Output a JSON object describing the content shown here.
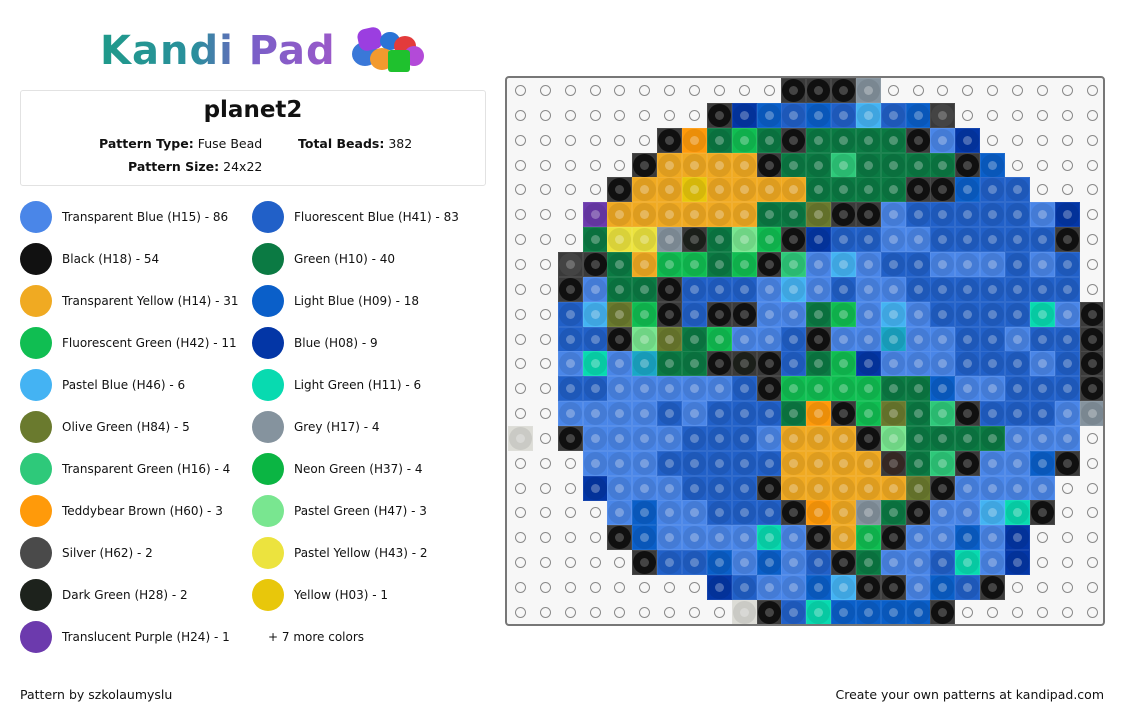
{
  "brand": {
    "name": "Kandi Pad"
  },
  "pattern": {
    "title": "planet2",
    "type_label": "Pattern Type:",
    "type_value": "Fuse Bead",
    "total_label": "Total Beads:",
    "total_value": "382",
    "size_label": "Pattern Size:",
    "size_value": "24x22"
  },
  "legend": {
    "items": [
      {
        "label": "Transparent Blue (H15) - 86",
        "color": "#4a86e8"
      },
      {
        "label": "Fluorescent Blue (H41) - 83",
        "color": "#2160c8"
      },
      {
        "label": "Black (H18) - 54",
        "color": "#111111"
      },
      {
        "label": "Green (H10) - 40",
        "color": "#0b7a43"
      },
      {
        "label": "Transparent Yellow (H14) - 31",
        "color": "#f0aa22"
      },
      {
        "label": "Light Blue (H09) - 18",
        "color": "#0a5fc9"
      },
      {
        "label": "Fluorescent Green (H42) - 11",
        "color": "#10be52"
      },
      {
        "label": "Blue (H08) - 9",
        "color": "#0336a6"
      },
      {
        "label": "Pastel Blue (H46) - 6",
        "color": "#44b3f3"
      },
      {
        "label": "Light Green (H11) - 6",
        "color": "#08dab0"
      },
      {
        "label": "Olive Green (H84) - 5",
        "color": "#6a7a2e"
      },
      {
        "label": "Grey (H17) - 4",
        "color": "#85939e"
      },
      {
        "label": "Transparent Green (H16) - 4",
        "color": "#2ec97a"
      },
      {
        "label": "Neon Green (H37) - 4",
        "color": "#0bb543"
      },
      {
        "label": "Teddybear Brown (H60) - 3",
        "color": "#ff9a0a"
      },
      {
        "label": "Pastel Green (H47) - 3",
        "color": "#79e690"
      },
      {
        "label": "Silver (H62) - 2",
        "color": "#4a4a4a"
      },
      {
        "label": "Pastel Yellow (H43) - 2",
        "color": "#ece33e"
      },
      {
        "label": "Dark Green (H28) - 2",
        "color": "#1d221c"
      },
      {
        "label": "Yellow (H03) - 1",
        "color": "#e8c70b"
      },
      {
        "label": "Translucent Purple (H24) - 1",
        "color": "#6c3aad"
      }
    ],
    "more_label": "+ 7 more colors"
  },
  "board": {
    "columns": 24,
    "rows": 22,
    "palette": {
      "B": "#4a86e8",
      "F": "#2160c8",
      "K": "#111111",
      "G": "#0b7a43",
      "Y": "#f0aa22",
      "L": "#0a5fc9",
      "N": "#10be52",
      "D": "#0336a6",
      "p": "#44b3f3",
      "M": "#08dab0",
      "O": "#6a7a2e",
      "Q": "#85939e",
      "T": "#2ec97a",
      "E": "#0bb543",
      "R": "#ff9a0a",
      "P": "#79e690",
      "S": "#4a4a4a",
      "W": "#ece33e",
      "X": "#1d221c",
      "U": "#e8c70b",
      "V": "#6c3aad",
      "C": "#1aa7c7",
      "Z": "#3a2a26",
      "w": "#dcdcd6"
    },
    "grid": [
      "...........KKKQ.........",
      "........KDLFLFpFLS......",
      "......KRGNGKGGGGKBD.....",
      ".....KYYYYKGGTGGGGKL....",
      "....KYYUYYYYGGGGKKLFF...",
      "...VYYYYYYGGOKKBFFFFFBD..",
      "...GWWQXGPNKDFFBBFFFFFK.",
      "..SKGYNNGNKTBpBFFBBBFBF.",
      "..KBGGKFFFBpBFBBFFFFFFF.",
      "..FpONKFKKBBGNBpBFFFFMBK",
      "..FFKPOGNBBFKBBCBBFFBFFK",
      "..BMBCGGKXKFGNDBBBFFFBFK",
      "..FFBBBBBFKNNNNGGLBBFFFK",
      "..BBBBFBFFFGRKNOGTKFFFBQ",
      "w.KBBBBFFFBYYYKPGGGGBBB.",
      "...BBBFFFFFYYYYZGTKBBLK.",
      "...DBBBFFFKYYYYYOKBBBB..",
      "....BLBBFFFKRYQGKBBpMK..",
      "....KLBBBBMBKYNKBBLBD...",
      ".....KFFLBLBFKGBBFMBD...",
      "........DFBBLpKKBLFK....",
      ".........wKFMLLLLK......"
    ]
  },
  "footer": {
    "credit": "Pattern by szkolaumyslu",
    "cta": "Create your own patterns at kandipad.com"
  }
}
